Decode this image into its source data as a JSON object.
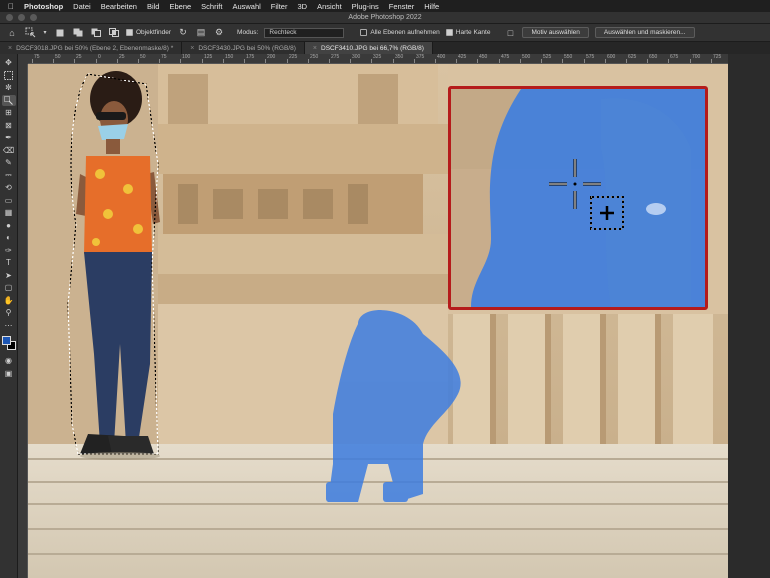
{
  "menubar": {
    "apple": "",
    "app": "Photoshop",
    "items": [
      "Datei",
      "Bearbeiten",
      "Bild",
      "Ebene",
      "Schrift",
      "Auswahl",
      "Filter",
      "3D",
      "Ansicht",
      "Plug-ins",
      "Fenster",
      "Hilfe"
    ]
  },
  "window": {
    "title": "Adobe Photoshop 2022"
  },
  "options": {
    "objektfinder_label": "Objektfinder",
    "modus_label": "Modus:",
    "modus_value": "Rechteck",
    "alle_ebenen_label": "Alle Ebenen aufnehmen",
    "harte_kante_label": "Harte Kante",
    "motiv_button": "Motiv auswählen",
    "auswaehlen_button": "Auswählen und maskieren..."
  },
  "tabs": [
    {
      "label": "DSCF3018.JPG bei 50% (Ebene 2, Ebenenmaske/8) *",
      "active": false
    },
    {
      "label": "DSCF3430.JPG bei 50% (RGB/8)",
      "active": false
    },
    {
      "label": "DSCF3410.JPG bei 66,7% (RGB/8)",
      "active": true
    }
  ],
  "ruler": {
    "top_labels": [
      "75",
      "50",
      "25",
      "0",
      "25",
      "50",
      "75",
      "100",
      "125",
      "150",
      "175",
      "200",
      "225",
      "250",
      "275",
      "300",
      "325",
      "350",
      "375",
      "400",
      "425",
      "450",
      "475",
      "500",
      "525",
      "550",
      "575",
      "600",
      "625",
      "650",
      "675",
      "700",
      "725"
    ]
  },
  "colors": {
    "foreground": "#1c56b5",
    "background": "#000000",
    "selection_overlay": "#3d7de0",
    "loupe_border": "#b51b1b"
  }
}
